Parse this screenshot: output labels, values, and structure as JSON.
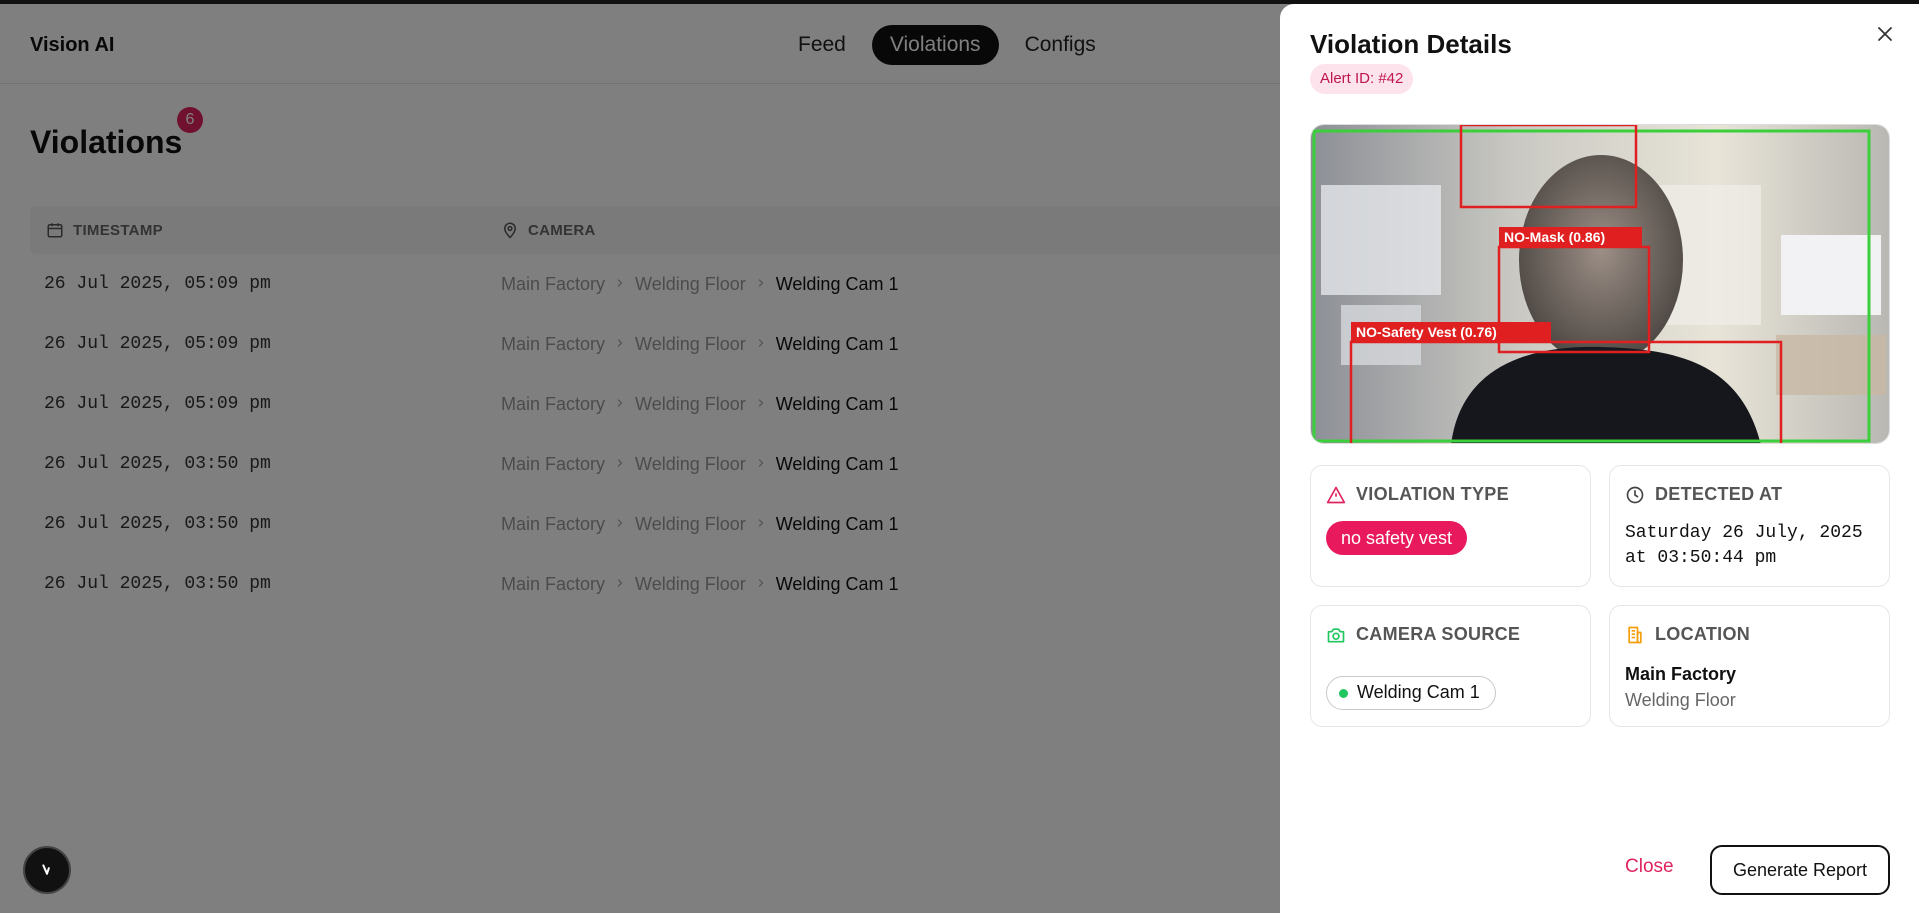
{
  "app": {
    "brand": "Vision AI"
  },
  "nav": {
    "items": [
      "Feed",
      "Violations",
      "Configs"
    ],
    "active": "Violations"
  },
  "page": {
    "title": "Violations",
    "count": "6"
  },
  "table": {
    "columns": [
      "TIMESTAMP",
      "CAMERA"
    ],
    "rows": [
      {
        "timestamp": "26 Jul 2025, 05:09 pm",
        "factory": "Main Factory",
        "floor": "Welding Floor",
        "camera": "Welding Cam 1"
      },
      {
        "timestamp": "26 Jul 2025, 05:09 pm",
        "factory": "Main Factory",
        "floor": "Welding Floor",
        "camera": "Welding Cam 1"
      },
      {
        "timestamp": "26 Jul 2025, 05:09 pm",
        "factory": "Main Factory",
        "floor": "Welding Floor",
        "camera": "Welding Cam 1"
      },
      {
        "timestamp": "26 Jul 2025, 03:50 pm",
        "factory": "Main Factory",
        "floor": "Welding Floor",
        "camera": "Welding Cam 1"
      },
      {
        "timestamp": "26 Jul 2025, 03:50 pm",
        "factory": "Main Factory",
        "floor": "Welding Floor",
        "camera": "Welding Cam 1"
      },
      {
        "timestamp": "26 Jul 2025, 03:50 pm",
        "factory": "Main Factory",
        "floor": "Welding Floor",
        "camera": "Welding Cam 1"
      }
    ]
  },
  "drawer": {
    "title": "Violation Details",
    "alert_id": "Alert ID: #42",
    "snapshot": {
      "detections": [
        "NO-Mask (0.86)",
        "NO-Safety Vest (0.76)"
      ]
    },
    "violation_type": {
      "label": "VIOLATION TYPE",
      "value": "no safety vest"
    },
    "detected_at": {
      "label": "DETECTED AT",
      "line1": "Saturday 26 July, 2025",
      "line2": "at 03:50:44 pm"
    },
    "camera_source": {
      "label": "CAMERA SOURCE",
      "value": "Welding Cam 1"
    },
    "location": {
      "label": "LOCATION",
      "main": "Main Factory",
      "sub": "Welding Floor"
    },
    "close_label": "Close",
    "report_label": "Generate Report"
  },
  "colors": {
    "accent": "#e0245e",
    "alert_pill_bg": "#fde3ec",
    "live_dot": "#22c55e",
    "location_icon": "#f59e0b",
    "camera_icon": "#22c55e"
  },
  "icons": [
    "calendar-icon",
    "map-pin-icon",
    "close-icon",
    "alert-triangle-icon",
    "clock-icon",
    "camera-icon",
    "building-icon",
    "chevron-right-icon"
  ]
}
